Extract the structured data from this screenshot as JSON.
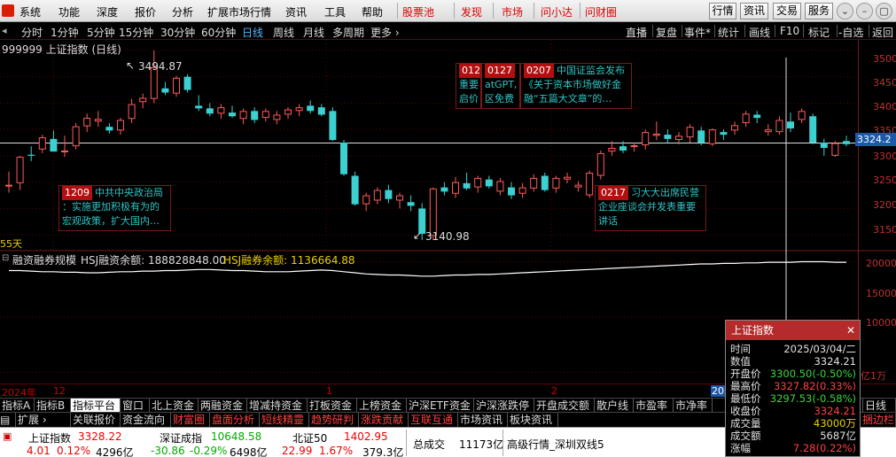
{
  "menu": {
    "items": [
      "系统",
      "功能",
      "深度",
      "报价",
      "分析",
      "扩展市场行情",
      "资讯",
      "工具",
      "帮助"
    ],
    "red_items": [
      "股票池",
      "发现",
      "市场",
      "问小达",
      "问财圈"
    ],
    "right_buttons": [
      "行情",
      "资讯",
      "交易",
      "服务"
    ],
    "window_controls": [
      "⌄",
      "–",
      "▢",
      "✕"
    ]
  },
  "periods": {
    "items": [
      "分时",
      "1分钟",
      "5分钟",
      "15分钟",
      "30分钟",
      "60分钟",
      "日线",
      "周线",
      "月线",
      "多周期",
      "更多 ›"
    ],
    "active": "日线",
    "tools": [
      "直播",
      "复盘",
      "事件*",
      "统计",
      "画线",
      "F10",
      "标记",
      "-自选",
      "返回"
    ]
  },
  "chart": {
    "title": "999999 上证指数 (日线)",
    "y_labels": [
      "3500",
      "3450",
      "3400",
      "3350",
      "3300",
      "3250",
      "3200",
      "3150"
    ],
    "cursor_price": "3324.2",
    "high_label": "3494.87",
    "low_label": "3140.98",
    "ma_label": "55天",
    "annotations": [
      {
        "date": "1209",
        "lines": [
          "中共中央政治局",
          "：实施更加积极有为的",
          "宏观政策，扩大国内…"
        ]
      },
      {
        "date": "012",
        "lines": [
          "",
          "重要",
          "启价"
        ]
      },
      {
        "date": "0127",
        "lines": [
          "",
          "atGPT,",
          "区免费"
        ]
      },
      {
        "date": "0207",
        "lines": [
          "中国证监会发布",
          "《关于资本市场做好金",
          "融“五篇大文章”的…"
        ]
      },
      {
        "date": "0217",
        "lines": [
          "习大大出席民营",
          "企业座谈会并发表重要",
          "讲话"
        ]
      }
    ]
  },
  "chart_data": {
    "type": "candlestick",
    "title": "999999 上证指数 (日线)",
    "ylim": [
      3120,
      3520
    ],
    "candles": [
      {
        "o": 3242,
        "h": 3270,
        "l": 3230,
        "c": 3245
      },
      {
        "o": 3248,
        "h": 3300,
        "l": 3235,
        "c": 3298
      },
      {
        "o": 3302,
        "h": 3318,
        "l": 3290,
        "c": 3300
      },
      {
        "o": 3312,
        "h": 3340,
        "l": 3305,
        "c": 3335
      },
      {
        "o": 3332,
        "h": 3348,
        "l": 3325,
        "c": 3308
      },
      {
        "o": 3308,
        "h": 3338,
        "l": 3298,
        "c": 3310
      },
      {
        "o": 3318,
        "h": 3362,
        "l": 3312,
        "c": 3356
      },
      {
        "o": 3356,
        "h": 3380,
        "l": 3345,
        "c": 3372
      },
      {
        "o": 3365,
        "h": 3385,
        "l": 3355,
        "c": 3370
      },
      {
        "o": 3355,
        "h": 3362,
        "l": 3342,
        "c": 3348
      },
      {
        "o": 3348,
        "h": 3372,
        "l": 3340,
        "c": 3368
      },
      {
        "o": 3370,
        "h": 3408,
        "l": 3362,
        "c": 3398
      },
      {
        "o": 3402,
        "h": 3418,
        "l": 3390,
        "c": 3410
      },
      {
        "o": 3408,
        "h": 3500,
        "l": 3400,
        "c": 3468
      },
      {
        "o": 3428,
        "h": 3440,
        "l": 3415,
        "c": 3420
      },
      {
        "o": 3418,
        "h": 3452,
        "l": 3412,
        "c": 3448
      },
      {
        "o": 3450,
        "h": 3455,
        "l": 3420,
        "c": 3425
      },
      {
        "o": 3395,
        "h": 3415,
        "l": 3385,
        "c": 3390
      },
      {
        "o": 3390,
        "h": 3400,
        "l": 3375,
        "c": 3380
      },
      {
        "o": 3380,
        "h": 3398,
        "l": 3370,
        "c": 3392
      },
      {
        "o": 3382,
        "h": 3395,
        "l": 3372,
        "c": 3375
      },
      {
        "o": 3370,
        "h": 3390,
        "l": 3360,
        "c": 3385
      },
      {
        "o": 3385,
        "h": 3392,
        "l": 3362,
        "c": 3368
      },
      {
        "o": 3372,
        "h": 3390,
        "l": 3365,
        "c": 3385
      },
      {
        "o": 3368,
        "h": 3385,
        "l": 3360,
        "c": 3378
      },
      {
        "o": 3378,
        "h": 3392,
        "l": 3370,
        "c": 3388
      },
      {
        "o": 3385,
        "h": 3398,
        "l": 3375,
        "c": 3392
      },
      {
        "o": 3395,
        "h": 3405,
        "l": 3380,
        "c": 3385
      },
      {
        "o": 3392,
        "h": 3398,
        "l": 3375,
        "c": 3378
      },
      {
        "o": 3385,
        "h": 3392,
        "l": 3328,
        "c": 3330
      },
      {
        "o": 3325,
        "h": 3330,
        "l": 3262,
        "c": 3265
      },
      {
        "o": 3262,
        "h": 3270,
        "l": 3205,
        "c": 3208
      },
      {
        "o": 3208,
        "h": 3230,
        "l": 3195,
        "c": 3225
      },
      {
        "o": 3215,
        "h": 3240,
        "l": 3208,
        "c": 3235
      },
      {
        "o": 3235,
        "h": 3245,
        "l": 3210,
        "c": 3218
      },
      {
        "o": 3215,
        "h": 3230,
        "l": 3200,
        "c": 3225
      },
      {
        "o": 3212,
        "h": 3225,
        "l": 3195,
        "c": 3205
      },
      {
        "o": 3200,
        "h": 3210,
        "l": 3140,
        "c": 3152
      },
      {
        "o": 3148,
        "h": 3240,
        "l": 3140,
        "c": 3238
      },
      {
        "o": 3240,
        "h": 3250,
        "l": 3225,
        "c": 3232
      },
      {
        "o": 3228,
        "h": 3260,
        "l": 3220,
        "c": 3250
      },
      {
        "o": 3248,
        "h": 3268,
        "l": 3235,
        "c": 3238
      },
      {
        "o": 3240,
        "h": 3262,
        "l": 3230,
        "c": 3258
      },
      {
        "o": 3255,
        "h": 3262,
        "l": 3238,
        "c": 3242
      },
      {
        "o": 3232,
        "h": 3258,
        "l": 3225,
        "c": 3252
      },
      {
        "o": 3240,
        "h": 3250,
        "l": 3218,
        "c": 3225
      },
      {
        "o": 3228,
        "h": 3248,
        "l": 3220,
        "c": 3240
      },
      {
        "o": 3238,
        "h": 3265,
        "l": 3232,
        "c": 3258
      },
      {
        "o": 3262,
        "h": 3268,
        "l": 3232,
        "c": 3235
      },
      {
        "o": 3238,
        "h": 3262,
        "l": 3230,
        "c": 3258
      },
      {
        "o": 3255,
        "h": 3268,
        "l": 3248,
        "c": 3260
      },
      {
        "o": 3240,
        "h": 3252,
        "l": 3232,
        "c": 3245
      },
      {
        "o": 3225,
        "h": 3272,
        "l": 3220,
        "c": 3268
      },
      {
        "o": 3262,
        "h": 3310,
        "l": 3255,
        "c": 3305
      },
      {
        "o": 3308,
        "h": 3328,
        "l": 3300,
        "c": 3315
      },
      {
        "o": 3318,
        "h": 3328,
        "l": 3305,
        "c": 3310
      },
      {
        "o": 3318,
        "h": 3325,
        "l": 3308,
        "c": 3320
      },
      {
        "o": 3320,
        "h": 3350,
        "l": 3312,
        "c": 3345
      },
      {
        "o": 3338,
        "h": 3365,
        "l": 3330,
        "c": 3342
      },
      {
        "o": 3340,
        "h": 3350,
        "l": 3325,
        "c": 3332
      },
      {
        "o": 3330,
        "h": 3345,
        "l": 3322,
        "c": 3338
      },
      {
        "o": 3335,
        "h": 3360,
        "l": 3325,
        "c": 3355
      },
      {
        "o": 3348,
        "h": 3355,
        "l": 3320,
        "c": 3325
      },
      {
        "o": 3322,
        "h": 3352,
        "l": 3318,
        "c": 3350
      },
      {
        "o": 3345,
        "h": 3350,
        "l": 3330,
        "c": 3340
      },
      {
        "o": 3348,
        "h": 3365,
        "l": 3340,
        "c": 3358
      },
      {
        "o": 3362,
        "h": 3385,
        "l": 3355,
        "c": 3380
      },
      {
        "o": 3378,
        "h": 3385,
        "l": 3362,
        "c": 3372
      },
      {
        "o": 3345,
        "h": 3360,
        "l": 3338,
        "c": 3350
      },
      {
        "o": 3345,
        "h": 3375,
        "l": 3340,
        "c": 3368
      },
      {
        "o": 3365,
        "h": 3382,
        "l": 3345,
        "c": 3352
      },
      {
        "o": 3368,
        "h": 3390,
        "l": 3362,
        "c": 3385
      },
      {
        "o": 3375,
        "h": 3380,
        "l": 3322,
        "c": 3325
      },
      {
        "o": 3325,
        "h": 3332,
        "l": 3300,
        "c": 3315
      },
      {
        "o": 3300,
        "h": 3328,
        "l": 3298,
        "c": 3324
      },
      {
        "o": 3328,
        "h": 3338,
        "l": 3318,
        "c": 3322
      }
    ],
    "hlines": [
      3500,
      3450,
      3400,
      3350,
      3300,
      3250,
      3200,
      3150
    ],
    "lower_panel": {
      "title": "融资融券规模",
      "label1": "HSJ融资余额: 188828848.00",
      "label2": "HSJ融券余额: 1136664.88",
      "y_labels": [
        "20000",
        "15000",
        "10000"
      ],
      "unit": "亿1万",
      "ylim": [
        9000,
        21000
      ],
      "line": [
        19200,
        19200,
        19150,
        19100,
        19100,
        19050,
        19050,
        19000,
        19000,
        19050,
        19100,
        19100,
        19150,
        19150,
        19200,
        19200,
        19250,
        19300,
        19300,
        19250,
        19200,
        19200,
        19150,
        19100,
        19100,
        19100,
        19150,
        19200,
        19250,
        19200,
        19100,
        19000,
        18900,
        18850,
        18800,
        18800,
        18750,
        18700,
        18700,
        18750,
        18800,
        18800,
        18850,
        18850,
        18900,
        18950,
        19000,
        19050,
        19100,
        19150,
        19200,
        19250,
        19300,
        19350,
        19400,
        19450,
        19500,
        19550,
        19600,
        19650,
        19700,
        19750,
        19800,
        19800,
        19850,
        19850,
        19900,
        19900,
        19950,
        19950,
        19950,
        20000,
        20000,
        20000,
        19950,
        19950
      ]
    }
  },
  "datebar": {
    "labels": [
      "2024年",
      "12",
      "1",
      "2",
      "20"
    ]
  },
  "tabs1": [
    "指标A",
    "指标B",
    "指标平台",
    "窗口",
    "北上资金",
    "两融资金",
    "增减持资金",
    "打板资金",
    "上榜资金",
    "沪深ETF资金",
    "沪深涨跌停",
    "开盘成交额",
    "散户线",
    "市盈率",
    "市净率",
    "日线"
  ],
  "tabs1_active": "指标平台",
  "tabs2": [
    "扩展 ›",
    "关联报价",
    "资金流向",
    "财富圈",
    "盘面分析",
    "短线精靈",
    "趋势研判",
    "涨跌贡献",
    "互联互通",
    "市场资讯",
    "板块资讯",
    "捆边栏"
  ],
  "status": {
    "idx1_name": "上证指数",
    "idx1_val": "3328.22",
    "idx1_chg": "4.01",
    "idx1_pct": "0.12%",
    "idx1_amt": "4296亿",
    "idx2_name": "深证成指",
    "idx2_val": "10648.58",
    "idx2_chg": "-30.86",
    "idx2_pct": "-0.29%",
    "idx2_amt": "6498亿",
    "idx3_name": "北证50",
    "idx3_val": "1402.95",
    "idx3_chg": "22.99",
    "idx3_pct": "1.67%",
    "idx3_amt": "379.3亿",
    "total_label": "总成交",
    "total_val": "11173亿",
    "right_text": "高级行情_深圳双线5"
  },
  "popup": {
    "title": "上证指数",
    "close": "✕",
    "rows": [
      {
        "k": "时间",
        "v": "2025/03/04/二",
        "c": "#e0e0e0"
      },
      {
        "k": "数值",
        "v": "3324.21",
        "c": "#e0e0e0"
      },
      {
        "k": "开盘价",
        "v": "3300.50(-0.50%)",
        "c": "#3ad63a"
      },
      {
        "k": "最高价",
        "v": "3327.82(0.33%)",
        "c": "#ff4040"
      },
      {
        "k": "最低价",
        "v": "3297.53(-0.58%)",
        "c": "#3ad63a"
      },
      {
        "k": "收盘价",
        "v": "3324.21",
        "c": "#ff4040"
      },
      {
        "k": "成交量",
        "v": "43000万",
        "c": "#e8d000"
      },
      {
        "k": "成交额",
        "v": "5687亿",
        "c": "#e0e0e0"
      },
      {
        "k": "涨幅",
        "v": "7.28(0.22%)",
        "c": "#ff4040"
      }
    ]
  },
  "colors": {
    "up": "#ff5a5a",
    "down": "#3cd0d0",
    "grid": "#5a0000",
    "cursor": "#e0e0e0"
  }
}
